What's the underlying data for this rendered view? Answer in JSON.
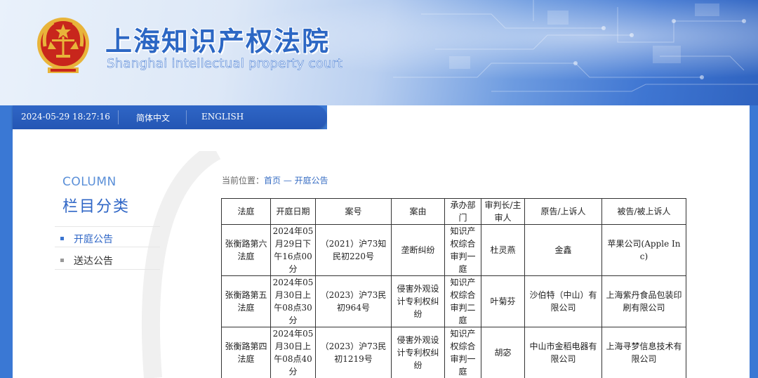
{
  "header": {
    "title": "上海知识产权法院",
    "subtitle": "Shanghai intellectual property court",
    "emblem_icon": "national-emblem-icon"
  },
  "nav": {
    "datetime": "2024-05-29 18:27:16",
    "lang_cn": "简体中文",
    "lang_en": "ENGLISH"
  },
  "sidebar": {
    "column_en": "COLUMN",
    "column_cn": "栏目分类",
    "items": [
      {
        "label": "开庭公告",
        "active": true
      },
      {
        "label": "送达公告",
        "active": false
      }
    ]
  },
  "breadcrumb": {
    "prefix": "当前位置：",
    "home": "首页",
    "sep": " — ",
    "current": "开庭公告"
  },
  "table": {
    "headers": [
      "法庭",
      "开庭日期",
      "案号",
      "案由",
      "承办部门",
      "审判长/主审人",
      "原告/上诉人",
      "被告/被上诉人"
    ],
    "rows": [
      [
        "张衡路第六法庭",
        "2024年05月29日下午16点00分",
        "（2021）沪73知民初220号",
        "垄断纠纷",
        "知识产权综合审判一庭",
        "杜灵燕",
        "金鑫",
        "苹果公司(Apple Inc)"
      ],
      [
        "张衡路第五法庭",
        "2024年05月30日上午08点30分",
        "（2023）沪73民初964号",
        "侵害外观设计专利权纠纷",
        "知识产权综合审判二庭",
        "叶菊芬",
        "沙伯特（中山）有限公司",
        "上海紫丹食品包装印刷有限公司"
      ],
      [
        "张衡路第四法庭",
        "2024年05月30日上午08点40分",
        "（2023）沪73民初1219号",
        "侵害外观设计专利权纠纷",
        "知识产权综合审判一庭",
        "胡宓",
        "中山市金稻电器有限公司",
        "上海寻梦信息技术有限公司"
      ]
    ]
  },
  "colors": {
    "brand_blue": "#2f66c6",
    "nav_blue": "#2456b4",
    "emblem_red": "#c8261c",
    "emblem_gold": "#e8b43a"
  }
}
